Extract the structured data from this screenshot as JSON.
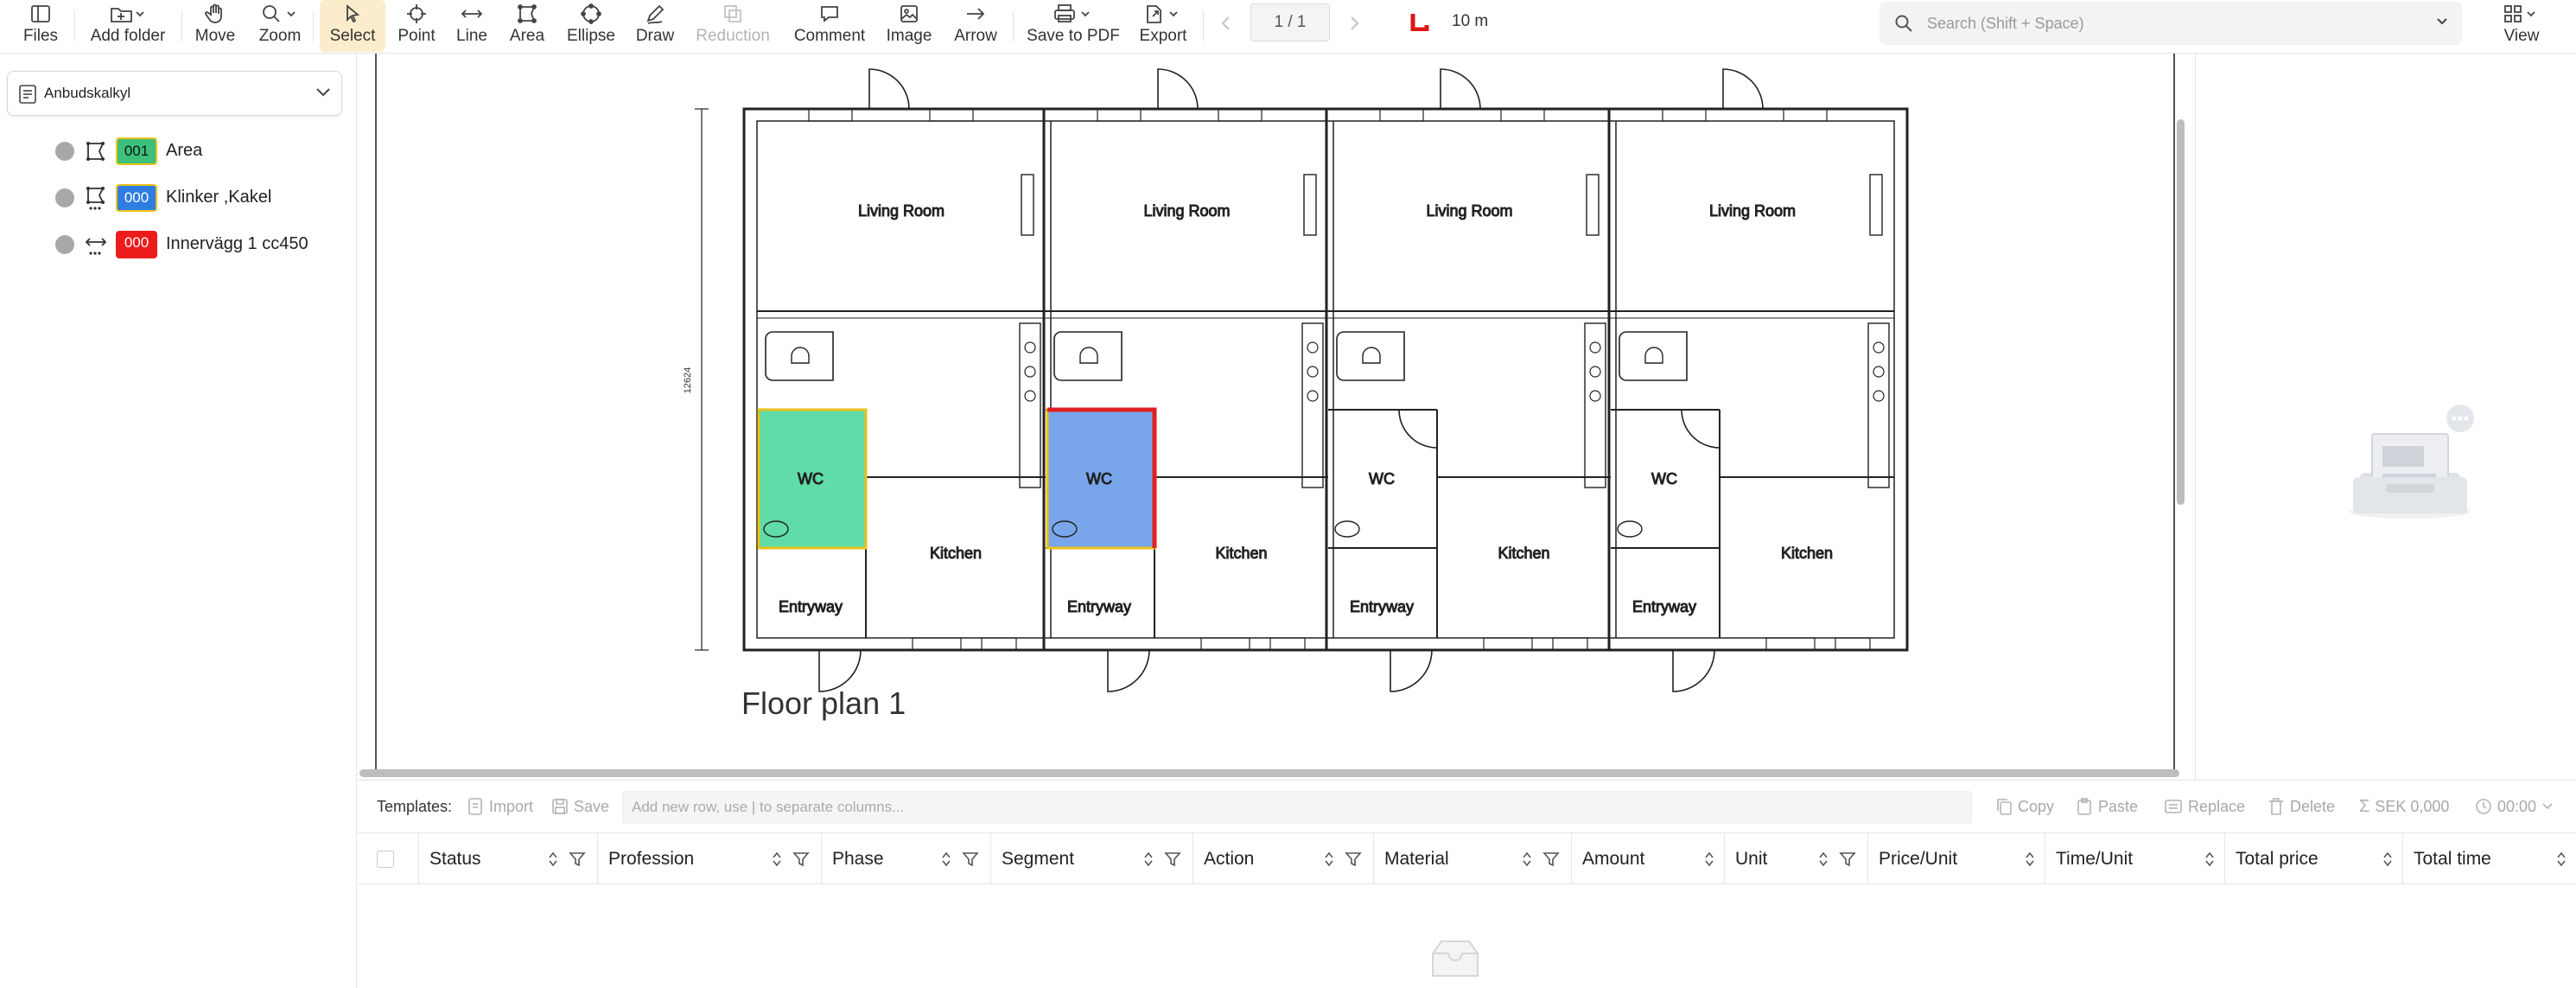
{
  "toolbar": {
    "files": "Files",
    "add_folder": "Add folder",
    "move": "Move",
    "zoom": "Zoom",
    "select": "Select",
    "point": "Point",
    "line": "Line",
    "area": "Area",
    "ellipse": "Ellipse",
    "draw": "Draw",
    "reduction": "Reduction",
    "comment": "Comment",
    "image": "Image",
    "arrow": "Arrow",
    "save_to_pdf": "Save to PDF",
    "export": "Export",
    "page_indicator": "1 / 1",
    "scale": "10 m",
    "search_placeholder": "Search (Shift + Space)",
    "view": "View"
  },
  "sidebar": {
    "folder": "Anbudskalkyl",
    "layers": [
      {
        "code": "001",
        "name": "Area",
        "color": "#3cc07a"
      },
      {
        "code": "000",
        "name": "Klinker ,Kakel",
        "color": "#2f7de1"
      },
      {
        "code": "000",
        "name": "Innervägg 1 cc450",
        "color": "#ec1c1c"
      }
    ]
  },
  "drawing": {
    "title": "Floor plan 1",
    "dimension": "12624",
    "rooms": {
      "living": "Living Room",
      "wc": "WC",
      "kitchen": "Kitchen",
      "entry": "Entryway"
    }
  },
  "bottom": {
    "templates_label": "Templates:",
    "import": "Import",
    "save": "Save",
    "row_placeholder": "Add new row, use | to separate columns...",
    "copy": "Copy",
    "paste": "Paste",
    "replace": "Replace",
    "delete": "Delete",
    "sum": "SEK 0,000",
    "time": "00:00",
    "columns": [
      "Status",
      "Profession",
      "Phase",
      "Segment",
      "Action",
      "Material",
      "Amount",
      "Unit",
      "Price/Unit",
      "Time/Unit",
      "Total price",
      "Total time"
    ]
  },
  "colors": {
    "accent_select": "#fbeccb",
    "area_green": "#5fdca8",
    "area_blue": "#79a6ea",
    "wall_red": "#e02020",
    "scale_red": "#e01818"
  }
}
